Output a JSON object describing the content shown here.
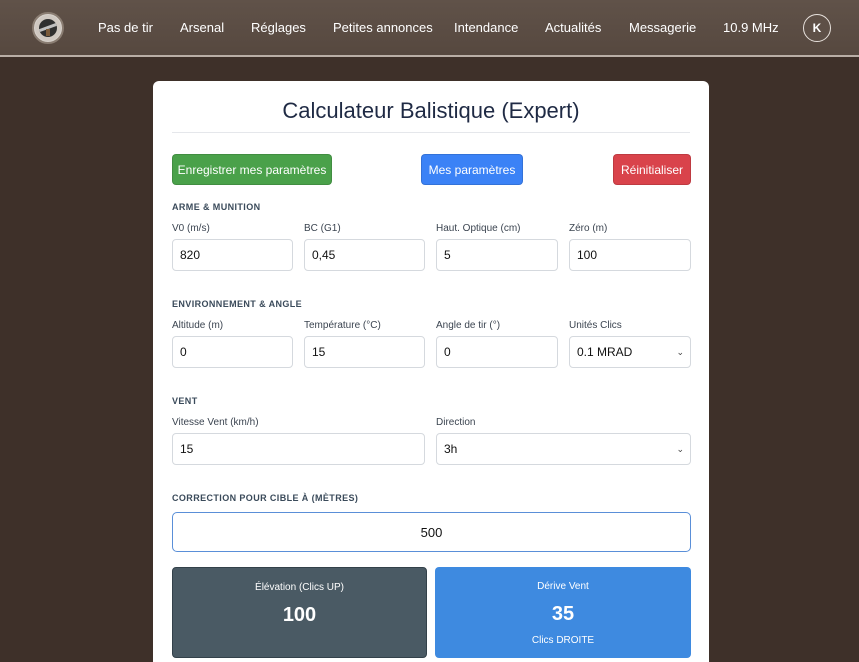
{
  "nav": {
    "items": [
      "Pas de tir",
      "Arsenal",
      "Réglages",
      "Petites annonces",
      "Intendance",
      "Actualités",
      "Messagerie",
      "10.9 MHz"
    ],
    "avatar_initial": "K"
  },
  "calculator": {
    "title": "Calculateur Balistique (Expert)",
    "buttons": {
      "save": "Enregistrer mes paramètres",
      "params": "Mes paramètres",
      "reset": "Réinitialiser"
    },
    "weapon": {
      "section": "ARME & MUNITION",
      "v0_label": "V0 (m/s)",
      "v0": "820",
      "bc_label": "BC (G1)",
      "bc": "0,45",
      "optic_label": "Haut. Optique (cm)",
      "optic": "5",
      "zero_label": "Zéro (m)",
      "zero": "100"
    },
    "environment": {
      "section": "ENVIRONNEMENT & ANGLE",
      "altitude_label": "Altitude (m)",
      "altitude": "0",
      "temp_label": "Température (°C)",
      "temp": "15",
      "angle_label": "Angle de tir (°)",
      "angle": "0",
      "units_label": "Unités Clics",
      "units": "0.1 MRAD"
    },
    "wind": {
      "section": "VENT",
      "speed_label": "Vitesse Vent (km/h)",
      "speed": "15",
      "direction_label": "Direction",
      "direction": "3h"
    },
    "target": {
      "section": "CORRECTION POUR CIBLE À (MÈTRES)",
      "distance": "500"
    },
    "results": {
      "elevation_label": "Élévation (Clics UP)",
      "elevation": "100",
      "drift_label": "Dérive Vent",
      "drift": "35",
      "drift_sub": "Clics DROITE"
    }
  }
}
